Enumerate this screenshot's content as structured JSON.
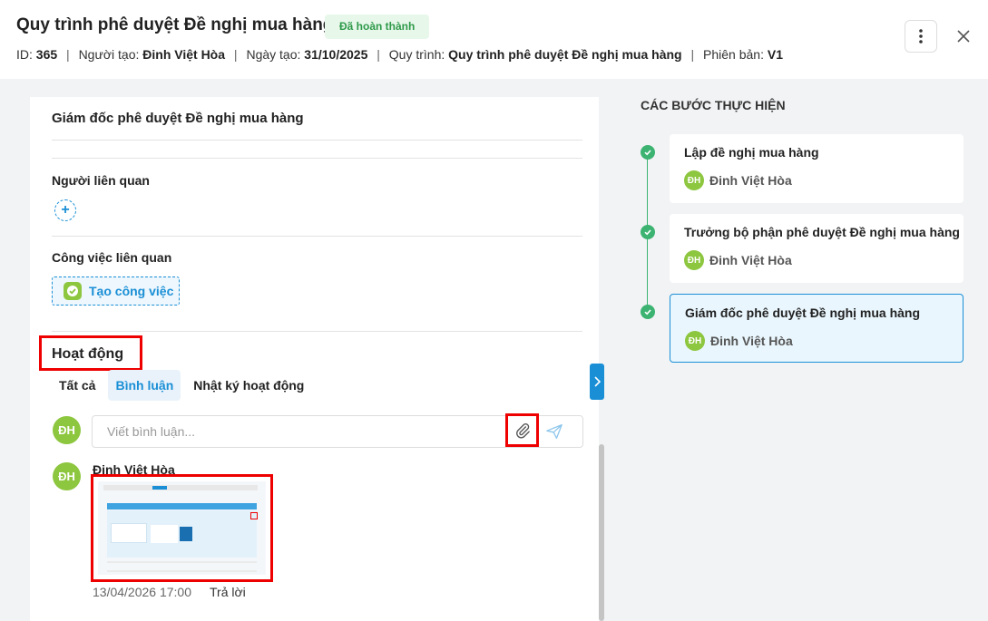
{
  "header": {
    "title": "Quy trình phê duyệt Đề nghị mua hàng",
    "status_badge": "Đã hoàn thành",
    "meta": {
      "id_label": "ID:",
      "id_value": "365",
      "creator_label": "Người tạo:",
      "creator_value": "Đinh Việt Hòa",
      "created_label": "Ngày tạo:",
      "created_value": "31/10/2025",
      "process_label": "Quy trình:",
      "process_value": "Quy trình phê duyệt Đề nghị mua hàng",
      "version_label": "Phiên bản:",
      "version_value": "V1",
      "separator": "|"
    }
  },
  "detail": {
    "step_title": "Giám đốc phê duyệt Đề nghị mua hàng",
    "related_people_label": "Người liên quan",
    "related_tasks_label": "Công việc liên quan",
    "create_task_label": "Tạo công việc",
    "add_icon": "+"
  },
  "activity": {
    "title": "Hoạt động",
    "tabs": [
      {
        "label": "Tất cả",
        "active": false
      },
      {
        "label": "Bình luận",
        "active": true
      },
      {
        "label": "Nhật ký hoạt động",
        "active": false
      }
    ],
    "input_placeholder": "Viết bình luận...",
    "current_user_initials": "ĐH",
    "comments": [
      {
        "author": "Đinh Việt Hòa",
        "initials": "ĐH",
        "time": "13/04/2026 17:00",
        "reply_label": "Trả lời"
      }
    ]
  },
  "steps": {
    "title": "CÁC BƯỚC THỰC HIỆN",
    "items": [
      {
        "name": "Lập đề nghị mua hàng",
        "user": "Đinh Việt Hòa",
        "initials": "ĐH",
        "active": false
      },
      {
        "name": "Trưởng bộ phận phê duyệt Đề nghị mua hàng",
        "user": "Đinh Việt Hòa",
        "initials": "ĐH",
        "active": false
      },
      {
        "name": "Giám đốc phê duyệt Đề nghị mua hàng",
        "user": "Đinh Việt Hòa",
        "initials": "ĐH",
        "active": true
      }
    ]
  },
  "colors": {
    "accent": "#1a8fd6",
    "success": "#3cb371",
    "avatar": "#8dc63f",
    "highlight": "#ee0000"
  }
}
